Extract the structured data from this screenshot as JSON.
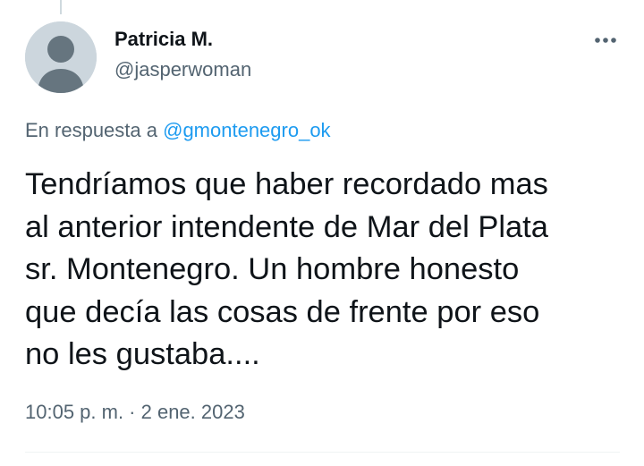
{
  "tweet": {
    "author": {
      "display_name": "Patricia M.",
      "handle": "@jasperwoman",
      "avatar_icon": "default-avatar-icon"
    },
    "more_icon": "more-horizontal-icon",
    "reply": {
      "prefix": "En respuesta a",
      "mention": "@gmontenegro_ok"
    },
    "text": "Tendríamos que haber recordado mas\nal anterior intendente de Mar del Plata\nsr. Montenegro. Un hombre honesto\nque decía las cosas de frente por eso\nno les gustaba....",
    "timestamp": "10:05 p. m. · 2 ene. 2023"
  },
  "colors": {
    "text_primary": "#0f1419",
    "text_secondary": "#536471",
    "link": "#1d9bf0",
    "avatar_bg": "#ccd6dd",
    "avatar_fg": "#66757f",
    "divider": "#eff3f4"
  }
}
